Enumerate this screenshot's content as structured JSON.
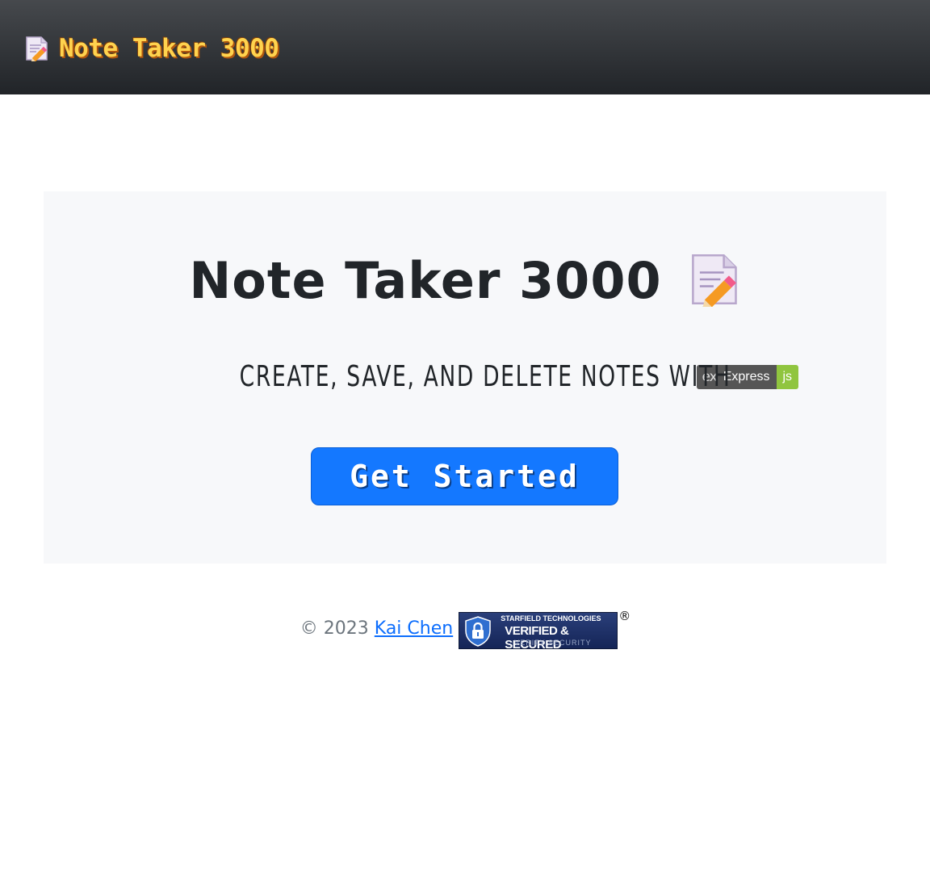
{
  "navbar": {
    "brand_label": "Note Taker 3000",
    "brand_icon": "memo-icon",
    "colors": {
      "background_top": "#46494d",
      "background_bottom": "#212428",
      "brand_text": "#ffd34e"
    }
  },
  "hero": {
    "title": "Note Taker 3000",
    "title_icon": "memo-icon",
    "subtitle": "CREATE, SAVE, AND DELETE NOTES WITH",
    "badge": {
      "logo": "ex",
      "label": "Express",
      "value": "js",
      "colors": {
        "left": "#555555",
        "right": "#90c53f"
      }
    },
    "cta_label": "Get Started",
    "colors": {
      "background": "#f7f8fa",
      "cta": "#1478ff"
    }
  },
  "footer": {
    "copyright": "© 2023",
    "author_link": "Kai Chen",
    "seal": {
      "line1": "STARFIELD TECHNOLOGIES",
      "line2": "VERIFIED & SECURED",
      "line3": "VERIFY SECURITY",
      "registered_mark": "®"
    },
    "colors": {
      "link": "#0d6efd",
      "text": "#6c757d"
    }
  }
}
